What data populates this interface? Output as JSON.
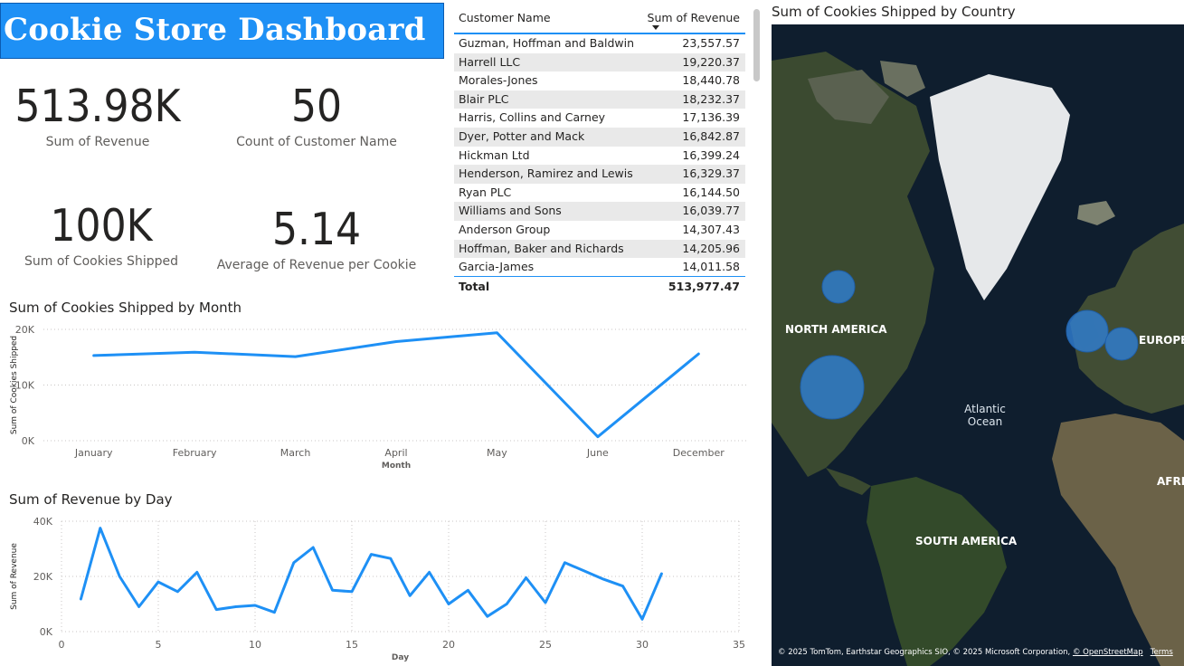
{
  "header": {
    "title": "Cookie Store Dashboard"
  },
  "kpis": {
    "revenue": {
      "value": "513.98K",
      "label": "Sum of Revenue"
    },
    "customers": {
      "value": "50",
      "label": "Count of Customer Name"
    },
    "cookies": {
      "value": "100K",
      "label": "Sum of Cookies Shipped"
    },
    "avg_revenue": {
      "value": "5.14",
      "label": "Average of Revenue per Cookie"
    }
  },
  "table": {
    "col_name": "Customer Name",
    "col_revenue": "Sum of Revenue",
    "rows": [
      {
        "name": "Guzman, Hoffman and Baldwin",
        "revenue": "23,557.57"
      },
      {
        "name": "Harrell LLC",
        "revenue": "19,220.37"
      },
      {
        "name": "Morales-Jones",
        "revenue": "18,440.78"
      },
      {
        "name": "Blair PLC",
        "revenue": "18,232.37"
      },
      {
        "name": "Harris, Collins and Carney",
        "revenue": "17,136.39"
      },
      {
        "name": "Dyer, Potter and Mack",
        "revenue": "16,842.87"
      },
      {
        "name": "Hickman Ltd",
        "revenue": "16,399.24"
      },
      {
        "name": "Henderson, Ramirez and Lewis",
        "revenue": "16,329.37"
      },
      {
        "name": "Ryan PLC",
        "revenue": "16,144.50"
      },
      {
        "name": "Williams and Sons",
        "revenue": "16,039.77"
      },
      {
        "name": "Anderson Group",
        "revenue": "14,307.43"
      },
      {
        "name": "Hoffman, Baker and Richards",
        "revenue": "14,205.96"
      },
      {
        "name": "Garcia-James",
        "revenue": "14,011.58"
      }
    ],
    "total_label": "Total",
    "total_value": "513,977.47"
  },
  "chart_data": [
    {
      "type": "line",
      "title": "Sum of Cookies Shipped by Month",
      "xlabel": "Month",
      "ylabel": "Sum of Cookies Shipped",
      "categories": [
        "January",
        "February",
        "March",
        "April",
        "May",
        "June",
        "December"
      ],
      "values": [
        15300,
        15900,
        15100,
        17800,
        19400,
        700,
        15600
      ],
      "ylim": [
        0,
        20000
      ],
      "yticks": [
        0,
        10000,
        20000
      ],
      "ytick_labels": [
        "0K",
        "10K",
        "20K"
      ],
      "grid": true,
      "color": "#1e90f5"
    },
    {
      "type": "line",
      "title": "Sum of Revenue by Day",
      "xlabel": "Day",
      "ylabel": "Sum of Revenue",
      "x": [
        1,
        2,
        3,
        4,
        5,
        6,
        7,
        8,
        9,
        10,
        11,
        12,
        13,
        14,
        15,
        16,
        17,
        18,
        19,
        20,
        21,
        22,
        23,
        24,
        25,
        26,
        27,
        28,
        29,
        30,
        31
      ],
      "values": [
        11800,
        37500,
        20000,
        9000,
        18000,
        14500,
        21500,
        8000,
        9000,
        9500,
        7000,
        25000,
        30500,
        15000,
        14500,
        28000,
        26500,
        13000,
        21500,
        10000,
        15000,
        5500,
        10000,
        19500,
        10500,
        25000,
        22000,
        19000,
        16500,
        4500,
        21000
      ],
      "xlim": [
        0,
        35
      ],
      "xticks": [
        0,
        5,
        10,
        15,
        20,
        25,
        30,
        35
      ],
      "ylim": [
        0,
        40000
      ],
      "yticks": [
        0,
        20000,
        40000
      ],
      "ytick_labels": [
        "0K",
        "20K",
        "40K"
      ],
      "grid": true,
      "color": "#1e90f5"
    }
  ],
  "map": {
    "title": "Sum of Cookies Shipped by Country",
    "labels": {
      "north_america": "NORTH AMERICA",
      "europe": "EUROPE",
      "atlantic_1": "Atlantic",
      "atlantic_2": "Ocean",
      "africa": "AFRICA",
      "south_america": "SOUTH AMERICA"
    },
    "attribution_prefix": "© 2025 TomTom, Earthstar Geographics SIO, © 2025 Microsoft Corporation, ",
    "osm_link": "© OpenStreetMap",
    "terms_link": "Terms",
    "bubble_color": "#2f7fd6"
  }
}
